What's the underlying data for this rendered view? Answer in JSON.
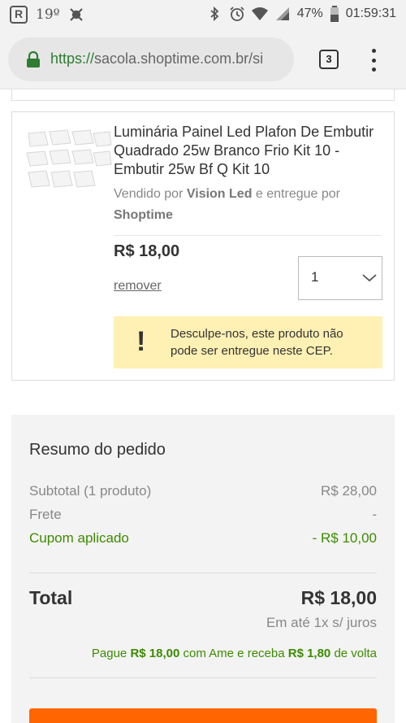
{
  "status_bar": {
    "temperature": "19º",
    "battery": "47%",
    "time": "01:59:31",
    "icons": [
      "r-app-icon",
      "weather-icon",
      "bug-icon",
      "bluetooth-icon",
      "alarm-icon",
      "wifi-icon",
      "signal-icon",
      "battery-icon"
    ]
  },
  "browser": {
    "url_scheme": "https://",
    "url_rest": "sacola.shoptime.com.br/si",
    "tab_count": "3"
  },
  "product": {
    "title": "Luminária Painel Led Plafon De Embutir Quadrado 25w Branco Frio Kit 10 - Embutir 25w Bf Q Kit 10",
    "seller_prefix": "Vendido por ",
    "seller_name": "Vision Led",
    "seller_middle": " e entregue por ",
    "delivered_by": "Shoptime",
    "price": "R$ 18,00",
    "remove_label": "remover",
    "quantity": "1",
    "warning_icon": "!",
    "warning_text": "Desculpe-nos, este produto não pode ser entregue neste CEP."
  },
  "summary": {
    "title": "Resumo do pedido",
    "subtotal_label": "Subtotal (1 produto)",
    "subtotal_value": "R$ 28,00",
    "shipping_label": "Frete",
    "shipping_value": "-",
    "coupon_label": "Cupom aplicado",
    "coupon_value": "- R$ 10,00",
    "total_label": "Total",
    "total_value": "R$ 18,00",
    "installments": "Em até 1x s/ juros",
    "ame_prefix": "Pague ",
    "ame_amount": "R$ 18,00",
    "ame_middle": " com Ame e receba ",
    "ame_cashback": "R$ 1,80",
    "ame_suffix": " de volta"
  },
  "colors": {
    "accent_orange": "#ff6500",
    "green": "#3d8b00",
    "warning_bg": "#fff0b3"
  }
}
